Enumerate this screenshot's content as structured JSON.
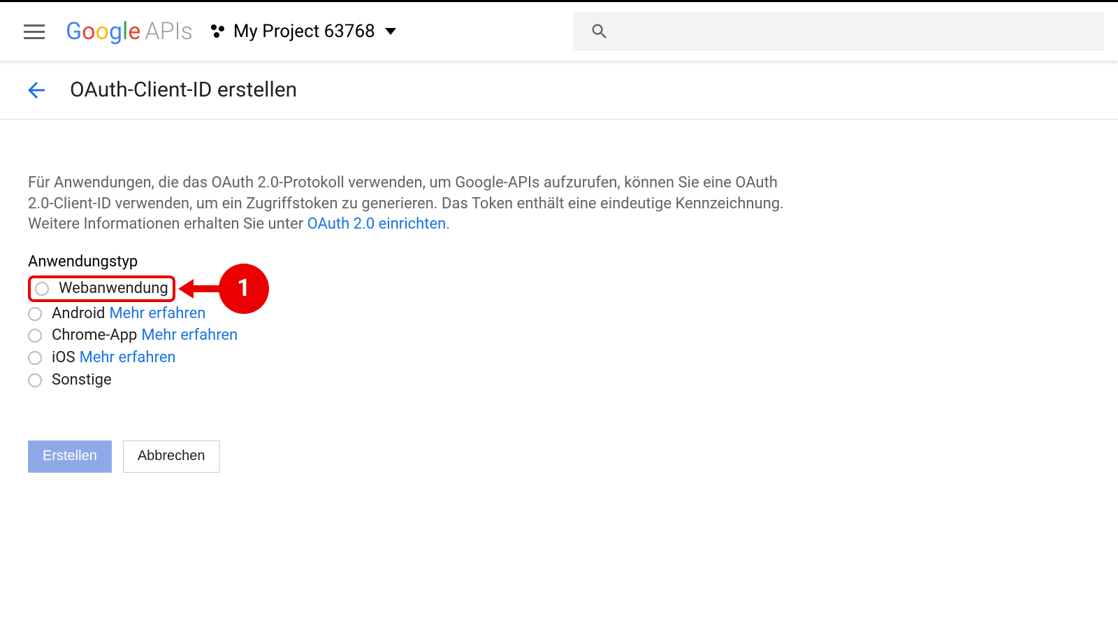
{
  "header": {
    "project_name": "My Project 63768"
  },
  "page": {
    "title": "OAuth-Client-ID erstellen",
    "description_pre": "Für Anwendungen, die das OAuth 2.0-Protokoll verwenden, um Google-APIs aufzurufen, können Sie eine OAuth 2.0-Client-ID verwenden, um ein Zugriffstoken zu generieren. Das Token enthält eine eindeutige Kennzeichnung. Weitere Informationen erhalten Sie unter ",
    "description_link": "OAuth 2.0 einrichten",
    "description_post": ".",
    "section_label": "Anwendungstyp"
  },
  "options": {
    "web": "Webanwendung",
    "android": "Android",
    "chrome": "Chrome-App",
    "ios": "iOS",
    "other": "Sonstige",
    "learn_more": "Mehr erfahren"
  },
  "callout": {
    "number": "1"
  },
  "buttons": {
    "create": "Erstellen",
    "cancel": "Abbrechen"
  }
}
